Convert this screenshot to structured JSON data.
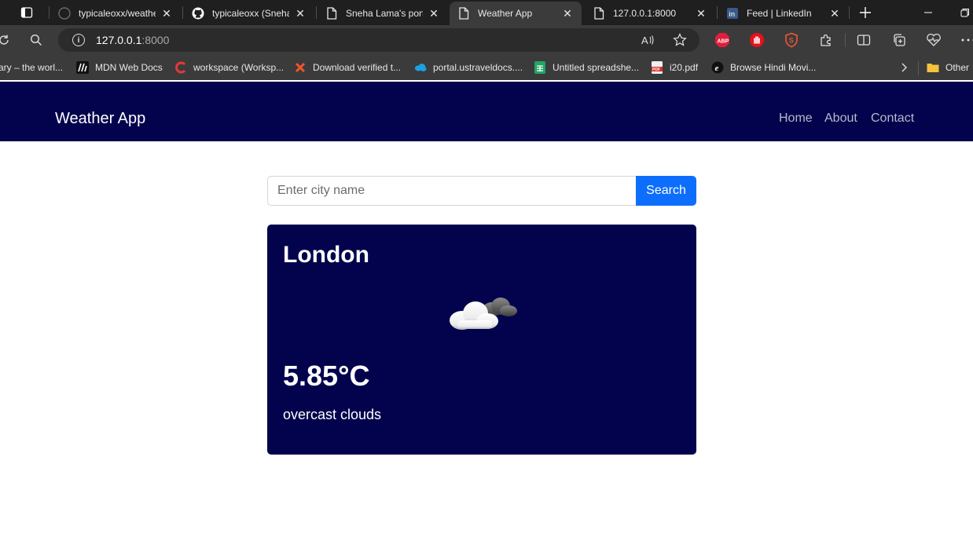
{
  "browser": {
    "tabs": [
      {
        "title": "typicaleoxx/weather",
        "icon": "github-icon",
        "active": false
      },
      {
        "title": "typicaleoxx (Sneha L",
        "icon": "github-icon",
        "active": false
      },
      {
        "title": "Sneha Lama's portfo",
        "icon": "page-icon",
        "active": false
      },
      {
        "title": "Weather App",
        "icon": "page-icon",
        "active": true
      },
      {
        "title": "127.0.0.1:8000",
        "icon": "page-icon",
        "active": false
      },
      {
        "title": "Feed | LinkedIn",
        "icon": "linkedin-icon",
        "active": false
      }
    ],
    "address": {
      "host": "127.0.0.1",
      "port": ":8000"
    },
    "bookmarks": [
      {
        "label": "ary – the worl...",
        "icon": "none"
      },
      {
        "label": "MDN Web Docs",
        "icon": "mdn-icon"
      },
      {
        "label": "workspace (Worksp...",
        "icon": "workspace-icon"
      },
      {
        "label": "Download verified t...",
        "icon": "x-icon"
      },
      {
        "label": "portal.ustraveldocs....",
        "icon": "cloud-icon"
      },
      {
        "label": "Untitled spreadshe...",
        "icon": "sheets-icon"
      },
      {
        "label": "i20.pdf",
        "icon": "pdf-icon"
      },
      {
        "label": "Browse Hindi Movi...",
        "icon": "e-icon"
      }
    ],
    "other_bookmarks": "Other",
    "colors": {
      "tabbar": "#1f1f1f",
      "toolbar": "#3b3b3b",
      "omnibox": "#2b2b2b"
    }
  },
  "navbar": {
    "brand": "Weather App",
    "links": [
      "Home",
      "About",
      "Contact"
    ]
  },
  "search": {
    "placeholder": "Enter city name",
    "value": "",
    "button": "Search"
  },
  "weather": {
    "city": "London",
    "temperature": "5.85°C",
    "description": "overcast clouds",
    "icon": "overcast-clouds-icon"
  },
  "colors": {
    "navy": "#03034d",
    "button_blue": "#0d6efd",
    "nav_link": "#b7b7c9",
    "page_bg": "#ffffff"
  }
}
